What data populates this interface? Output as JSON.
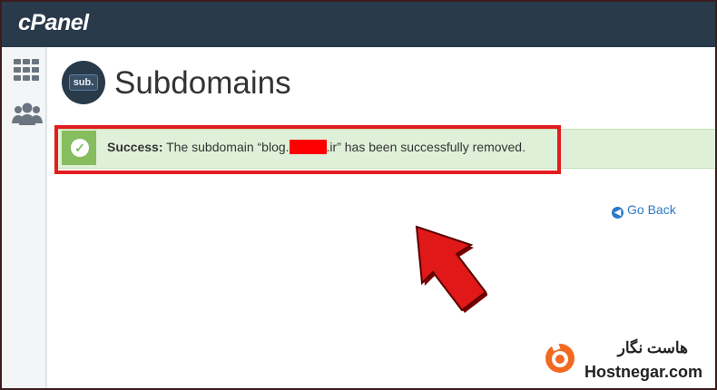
{
  "header": {
    "logo_text": "cPanel"
  },
  "page": {
    "title": "Subdomains",
    "icon_label": "sub."
  },
  "alert": {
    "strong": "Success:",
    "text_before": " The subdomain “blog.",
    "text_after": ".ir” has been successfully removed."
  },
  "links": {
    "go_back": "Go Back"
  },
  "branding": {
    "name_fa": "هاست نگار",
    "name_en": "Hostnegar.com"
  },
  "colors": {
    "topbar": "#293a4a",
    "success_bg": "#dff0d8",
    "success_strip": "#85bd5f",
    "highlight": "#e21d1d",
    "link": "#2e78c7"
  }
}
